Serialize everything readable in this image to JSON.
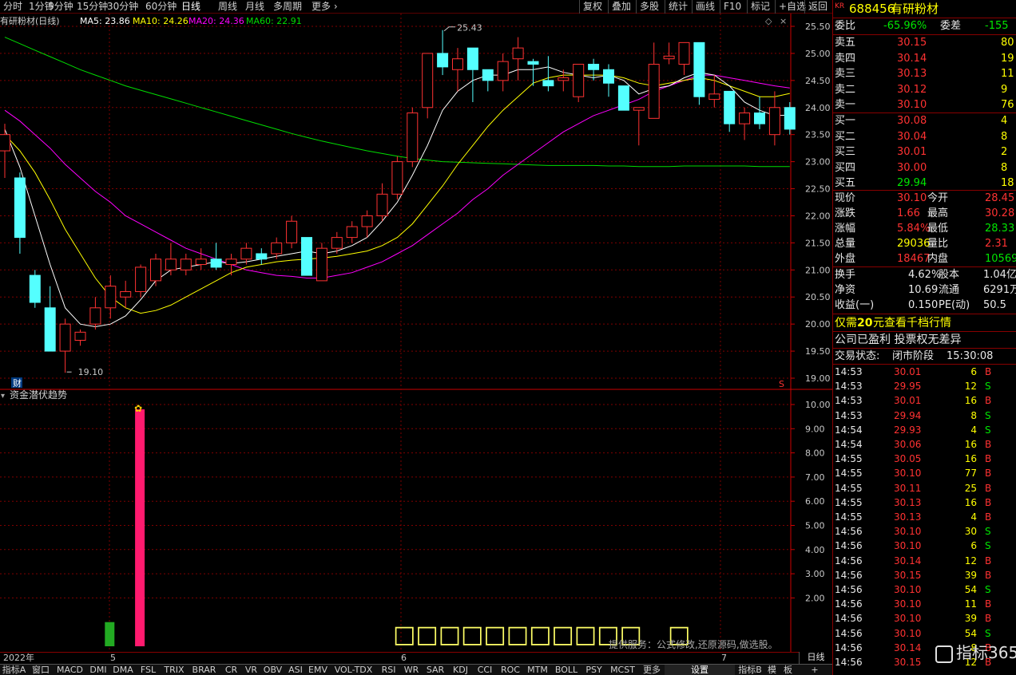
{
  "toolbar": {
    "left": [
      "分时",
      "1分钟",
      "5分钟",
      "15分钟",
      "30分钟",
      "60分钟",
      "日线",
      "周线",
      "月线",
      "多周期",
      "更多"
    ],
    "right": [
      "复权",
      "叠加",
      "多股",
      "统计",
      "画线",
      "F10",
      "标记",
      "+自选",
      "返回"
    ]
  },
  "main_header": {
    "name": "有研粉材(日线)",
    "ma5": "MA5: 23.86",
    "ma10": "MA10: 24.26",
    "ma20": "MA20: 24.36",
    "ma60": "MA60: 22.91",
    "high_label": "25.43",
    "low_label": "19.10",
    "fin_badge": "财",
    "s_badge": "S"
  },
  "indicator_header": {
    "name": "资金潜伏趋势",
    "placeholder_text": "□□□□□□□□□□□",
    "placeholder_single": "□",
    "provider": "提供服务：公式修改,还原源码,做选股。"
  },
  "date_strip": {
    "labels": [
      "2022年",
      "5",
      "6",
      "7"
    ],
    "mode": "日线"
  },
  "tabs": [
    "指标A",
    "窗口",
    "MACD",
    "DMI",
    "DMA",
    "FSL",
    "TRIX",
    "BRAR",
    "CR",
    "VR",
    "OBV",
    "ASI",
    "EMV",
    "VOL-TDX",
    "RSI",
    "WR",
    "SAR",
    "KDJ",
    "CCI",
    "ROC",
    "MTM",
    "BOLL",
    "PSY",
    "MCST",
    "更多",
    "设置",
    "指标B",
    "模",
    "板",
    "+"
  ],
  "quote": {
    "badge": "KR",
    "code": "688456",
    "name": "有研粉材",
    "webi_label": "委比",
    "webi": "-65.96%",
    "weicha_label": "委差",
    "weicha": "-155",
    "sell": [
      {
        "label": "卖五",
        "price": "30.15",
        "vol": "80"
      },
      {
        "label": "卖四",
        "price": "30.14",
        "vol": "19"
      },
      {
        "label": "卖三",
        "price": "30.13",
        "vol": "11"
      },
      {
        "label": "卖二",
        "price": "30.12",
        "vol": "9"
      },
      {
        "label": "卖一",
        "price": "30.10",
        "vol": "76"
      }
    ],
    "buy": [
      {
        "label": "买一",
        "price": "30.08",
        "vol": "4"
      },
      {
        "label": "买二",
        "price": "30.04",
        "vol": "8"
      },
      {
        "label": "买三",
        "price": "30.01",
        "vol": "2"
      },
      {
        "label": "买四",
        "price": "30.00",
        "vol": "8"
      },
      {
        "label": "买五",
        "price": "29.94",
        "vol": "18"
      }
    ],
    "stats": [
      {
        "l1": "现价",
        "v1": "30.10",
        "c1": "red",
        "l2": "今开",
        "v2": "28.45",
        "c2": "red"
      },
      {
        "l1": "涨跌",
        "v1": "1.66",
        "c1": "red",
        "l2": "最高",
        "v2": "30.28",
        "c2": "red"
      },
      {
        "l1": "涨幅",
        "v1": "5.84%",
        "c1": "red",
        "l2": "最低",
        "v2": "28.33",
        "c2": "green"
      },
      {
        "l1": "总量",
        "v1": "29036",
        "c1": "yellow",
        "l2": "量比",
        "v2": "2.31",
        "c2": "red"
      },
      {
        "l1": "外盘",
        "v1": "18467",
        "c1": "red",
        "l2": "内盘",
        "v2": "10569",
        "c2": "green"
      }
    ],
    "stats2": [
      {
        "l1": "换手",
        "v1": "4.62%",
        "l2": "股本",
        "v2": "1.04亿"
      },
      {
        "l1": "净资",
        "v1": "10.69",
        "l2": "流通",
        "v2": "6291万"
      },
      {
        "l1": "收益(一)",
        "v1": "0.150",
        "l2": "PE(动)",
        "v2": "50.5"
      }
    ],
    "promo_pre": "仅需",
    "promo_num": "20",
    "promo_post": "元查看千档行情",
    "notice": "公司已盈利 投票权无差异",
    "status_label": "交易状态:",
    "status": "闭市阶段",
    "status_time": "15:30:08",
    "watermark": "指标365"
  },
  "trades": [
    {
      "t": "14:53",
      "p": "30.01",
      "v": "6",
      "s": "B"
    },
    {
      "t": "14:53",
      "p": "29.95",
      "v": "12",
      "s": "S"
    },
    {
      "t": "14:53",
      "p": "30.01",
      "v": "16",
      "s": "B"
    },
    {
      "t": "14:53",
      "p": "29.94",
      "v": "8",
      "s": "S"
    },
    {
      "t": "14:54",
      "p": "29.93",
      "v": "4",
      "s": "S"
    },
    {
      "t": "14:54",
      "p": "30.06",
      "v": "16",
      "s": "B"
    },
    {
      "t": "14:55",
      "p": "30.05",
      "v": "16",
      "s": "B"
    },
    {
      "t": "14:55",
      "p": "30.10",
      "v": "77",
      "s": "B"
    },
    {
      "t": "14:55",
      "p": "30.11",
      "v": "25",
      "s": "B"
    },
    {
      "t": "14:55",
      "p": "30.13",
      "v": "16",
      "s": "B"
    },
    {
      "t": "14:55",
      "p": "30.13",
      "v": "4",
      "s": "B"
    },
    {
      "t": "14:56",
      "p": "30.10",
      "v": "30",
      "s": "S"
    },
    {
      "t": "14:56",
      "p": "30.10",
      "v": "6",
      "s": "S"
    },
    {
      "t": "14:56",
      "p": "30.14",
      "v": "12",
      "s": "B"
    },
    {
      "t": "14:56",
      "p": "30.15",
      "v": "39",
      "s": "B"
    },
    {
      "t": "14:56",
      "p": "30.10",
      "v": "54",
      "s": "S"
    },
    {
      "t": "14:56",
      "p": "30.10",
      "v": "11",
      "s": "B"
    },
    {
      "t": "14:56",
      "p": "30.10",
      "v": "39",
      "s": "B"
    },
    {
      "t": "14:56",
      "p": "30.10",
      "v": "54",
      "s": "S"
    },
    {
      "t": "14:56",
      "p": "30.14",
      "v": "8",
      "s": "B"
    },
    {
      "t": "14:56",
      "p": "30.15",
      "v": "12",
      "s": "B"
    }
  ],
  "chart_data": [
    {
      "type": "candlestick",
      "title": "有研粉材(日线)",
      "ylim": [
        19.0,
        25.5
      ],
      "yticks": [
        "25.50",
        "25.00",
        "24.50",
        "24.00",
        "23.50",
        "23.00",
        "22.50",
        "22.00",
        "21.50",
        "21.00",
        "20.50",
        "20.00",
        "19.50",
        "19.00"
      ],
      "candles": [
        {
          "o": 23.2,
          "c": 23.5,
          "h": 23.7,
          "l": 22.7
        },
        {
          "o": 22.7,
          "c": 21.6,
          "h": 22.8,
          "l": 21.3
        },
        {
          "o": 20.9,
          "c": 20.4,
          "h": 21.0,
          "l": 20.3
        },
        {
          "o": 20.3,
          "c": 19.5,
          "h": 20.7,
          "l": 19.5
        },
        {
          "o": 19.5,
          "c": 20.0,
          "h": 20.1,
          "l": 19.1
        },
        {
          "o": 19.7,
          "c": 19.85,
          "h": 19.9,
          "l": 19.6
        },
        {
          "o": 20.0,
          "c": 20.3,
          "h": 20.5,
          "l": 19.9
        },
        {
          "o": 20.3,
          "c": 20.7,
          "h": 20.9,
          "l": 20.1
        },
        {
          "o": 20.5,
          "c": 20.6,
          "h": 20.8,
          "l": 20.3
        },
        {
          "o": 20.6,
          "c": 21.05,
          "h": 21.1,
          "l": 20.5
        },
        {
          "o": 20.8,
          "c": 21.2,
          "h": 21.3,
          "l": 20.7
        },
        {
          "o": 21.0,
          "c": 21.2,
          "h": 21.5,
          "l": 20.9
        },
        {
          "o": 21.0,
          "c": 21.2,
          "h": 21.3,
          "l": 20.9
        },
        {
          "o": 21.1,
          "c": 21.2,
          "h": 21.4,
          "l": 21.0
        },
        {
          "o": 21.2,
          "c": 21.05,
          "h": 21.5,
          "l": 21.0
        },
        {
          "o": 21.1,
          "c": 21.2,
          "h": 21.3,
          "l": 20.9
        },
        {
          "o": 21.2,
          "c": 21.4,
          "h": 21.5,
          "l": 21.1
        },
        {
          "o": 21.3,
          "c": 21.2,
          "h": 21.4,
          "l": 21.1
        },
        {
          "o": 21.3,
          "c": 21.5,
          "h": 21.6,
          "l": 21.2
        },
        {
          "o": 21.5,
          "c": 21.9,
          "h": 22.0,
          "l": 21.4
        },
        {
          "o": 21.6,
          "c": 20.9,
          "h": 21.6,
          "l": 20.9
        },
        {
          "o": 20.8,
          "c": 21.4,
          "h": 21.5,
          "l": 20.8
        },
        {
          "o": 21.4,
          "c": 21.6,
          "h": 21.7,
          "l": 21.3
        },
        {
          "o": 21.6,
          "c": 21.8,
          "h": 21.9,
          "l": 21.5
        },
        {
          "o": 21.8,
          "c": 22.0,
          "h": 22.1,
          "l": 21.6
        },
        {
          "o": 22.0,
          "c": 22.4,
          "h": 22.6,
          "l": 21.9
        },
        {
          "o": 22.4,
          "c": 23.0,
          "h": 23.1,
          "l": 22.3
        },
        {
          "o": 23.0,
          "c": 23.9,
          "h": 24.0,
          "l": 22.9
        },
        {
          "o": 24.0,
          "c": 25.0,
          "h": 25.0,
          "l": 23.8
        },
        {
          "o": 25.0,
          "c": 24.75,
          "h": 25.43,
          "l": 24.6
        },
        {
          "o": 24.7,
          "c": 24.9,
          "h": 25.1,
          "l": 24.3
        },
        {
          "o": 25.1,
          "c": 24.7,
          "h": 25.1,
          "l": 24.1
        },
        {
          "o": 24.7,
          "c": 24.5,
          "h": 24.7,
          "l": 24.3
        },
        {
          "o": 24.5,
          "c": 24.85,
          "h": 25.0,
          "l": 24.3
        },
        {
          "o": 24.9,
          "c": 25.1,
          "h": 25.3,
          "l": 24.5
        },
        {
          "o": 24.85,
          "c": 24.8,
          "h": 24.9,
          "l": 24.4
        },
        {
          "o": 24.5,
          "c": 24.4,
          "h": 24.95,
          "l": 24.3
        },
        {
          "o": 24.5,
          "c": 24.55,
          "h": 24.7,
          "l": 24.3
        },
        {
          "o": 24.2,
          "c": 24.8,
          "h": 24.8,
          "l": 24.1
        },
        {
          "o": 24.8,
          "c": 24.7,
          "h": 24.9,
          "l": 24.5
        },
        {
          "o": 24.7,
          "c": 24.45,
          "h": 24.8,
          "l": 24.2
        },
        {
          "o": 24.4,
          "c": 23.95,
          "h": 24.4,
          "l": 23.95
        },
        {
          "o": 23.95,
          "c": 24.0,
          "h": 24.0,
          "l": 23.3
        },
        {
          "o": 23.8,
          "c": 24.8,
          "h": 25.2,
          "l": 23.8
        },
        {
          "o": 24.9,
          "c": 24.95,
          "h": 25.2,
          "l": 24.8
        },
        {
          "o": 24.8,
          "c": 25.2,
          "h": 25.2,
          "l": 24.6
        },
        {
          "o": 25.2,
          "c": 24.2,
          "h": 25.2,
          "l": 24.05
        },
        {
          "o": 24.15,
          "c": 24.25,
          "h": 24.6,
          "l": 24.0
        },
        {
          "o": 24.3,
          "c": 23.7,
          "h": 24.3,
          "l": 23.55
        },
        {
          "o": 23.7,
          "c": 23.9,
          "h": 24.0,
          "l": 23.4
        },
        {
          "o": 23.9,
          "c": 23.7,
          "h": 24.2,
          "l": 23.6
        },
        {
          "o": 23.5,
          "c": 24.0,
          "h": 24.3,
          "l": 23.3
        },
        {
          "o": 24.0,
          "c": 23.6,
          "h": 24.1,
          "l": 23.5
        }
      ],
      "ma5": [
        23.6,
        22.9,
        22.0,
        21.1,
        20.3,
        20.0,
        19.95,
        20.0,
        20.15,
        20.45,
        20.8,
        21.0,
        21.05,
        21.1,
        21.15,
        21.12,
        21.15,
        21.2,
        21.25,
        21.3,
        21.35,
        21.3,
        21.35,
        21.45,
        21.6,
        21.9,
        22.25,
        22.75,
        23.3,
        23.95,
        24.3,
        24.5,
        24.6,
        24.6,
        24.7,
        24.7,
        24.75,
        24.65,
        24.6,
        24.55,
        24.6,
        24.5,
        24.25,
        24.35,
        24.4,
        24.55,
        24.65,
        24.6,
        24.4,
        24.1,
        23.95,
        23.85,
        23.86
      ],
      "ma10": [
        23.5,
        23.2,
        22.8,
        22.3,
        21.75,
        21.3,
        20.85,
        20.5,
        20.3,
        20.2,
        20.25,
        20.35,
        20.5,
        20.65,
        20.8,
        20.95,
        21.05,
        21.1,
        21.15,
        21.18,
        21.2,
        21.22,
        21.25,
        21.3,
        21.35,
        21.45,
        21.6,
        21.85,
        22.2,
        22.55,
        22.95,
        23.3,
        23.65,
        23.95,
        24.2,
        24.45,
        24.55,
        24.6,
        24.6,
        24.6,
        24.6,
        24.55,
        24.45,
        24.4,
        24.45,
        24.5,
        24.55,
        24.5,
        24.4,
        24.3,
        24.2,
        24.2,
        24.26
      ],
      "ma20": [
        23.95,
        23.75,
        23.5,
        23.25,
        22.95,
        22.7,
        22.45,
        22.25,
        22.0,
        21.85,
        21.7,
        21.55,
        21.4,
        21.3,
        21.2,
        21.1,
        21.0,
        20.95,
        20.9,
        20.88,
        20.85,
        20.85,
        20.9,
        20.95,
        21.05,
        21.15,
        21.3,
        21.45,
        21.65,
        21.85,
        22.05,
        22.3,
        22.5,
        22.75,
        22.95,
        23.15,
        23.35,
        23.55,
        23.7,
        23.85,
        23.95,
        24.05,
        24.15,
        24.3,
        24.4,
        24.5,
        24.6,
        24.6,
        24.55,
        24.5,
        24.45,
        24.4,
        24.36
      ],
      "ma60": [
        25.3,
        25.18,
        25.06,
        24.94,
        24.82,
        24.7,
        24.6,
        24.5,
        24.4,
        24.32,
        24.24,
        24.16,
        24.08,
        24.0,
        23.92,
        23.84,
        23.76,
        23.68,
        23.6,
        23.52,
        23.45,
        23.38,
        23.32,
        23.26,
        23.2,
        23.15,
        23.1,
        23.06,
        23.03,
        23.0,
        22.99,
        22.98,
        22.97,
        22.96,
        22.95,
        22.94,
        22.93,
        22.93,
        22.93,
        22.93,
        22.92,
        22.92,
        22.91,
        22.91,
        22.91,
        22.92,
        22.92,
        22.92,
        22.92,
        22.92,
        22.91,
        22.91,
        22.91
      ]
    },
    {
      "type": "bar",
      "title": "资金潜伏趋势",
      "ylim": [
        0,
        10.8
      ],
      "yticks": [
        "10.00",
        "9.00",
        "8.00",
        "7.00",
        "6.00",
        "5.00",
        "4.00",
        "3.00",
        "2.00"
      ],
      "bars": [
        {
          "index": 7,
          "value": 1.0,
          "color": "#22aa22"
        },
        {
          "index": 9,
          "value": 9.8,
          "color": "#ff1a6e"
        }
      ]
    }
  ],
  "colors": {
    "up": "#ff3232",
    "down": "#54ffff",
    "ma5": "#ffffff",
    "ma10": "#ffff00",
    "ma20": "#ff00ff",
    "ma60": "#00dd00",
    "grid": "#800000"
  }
}
